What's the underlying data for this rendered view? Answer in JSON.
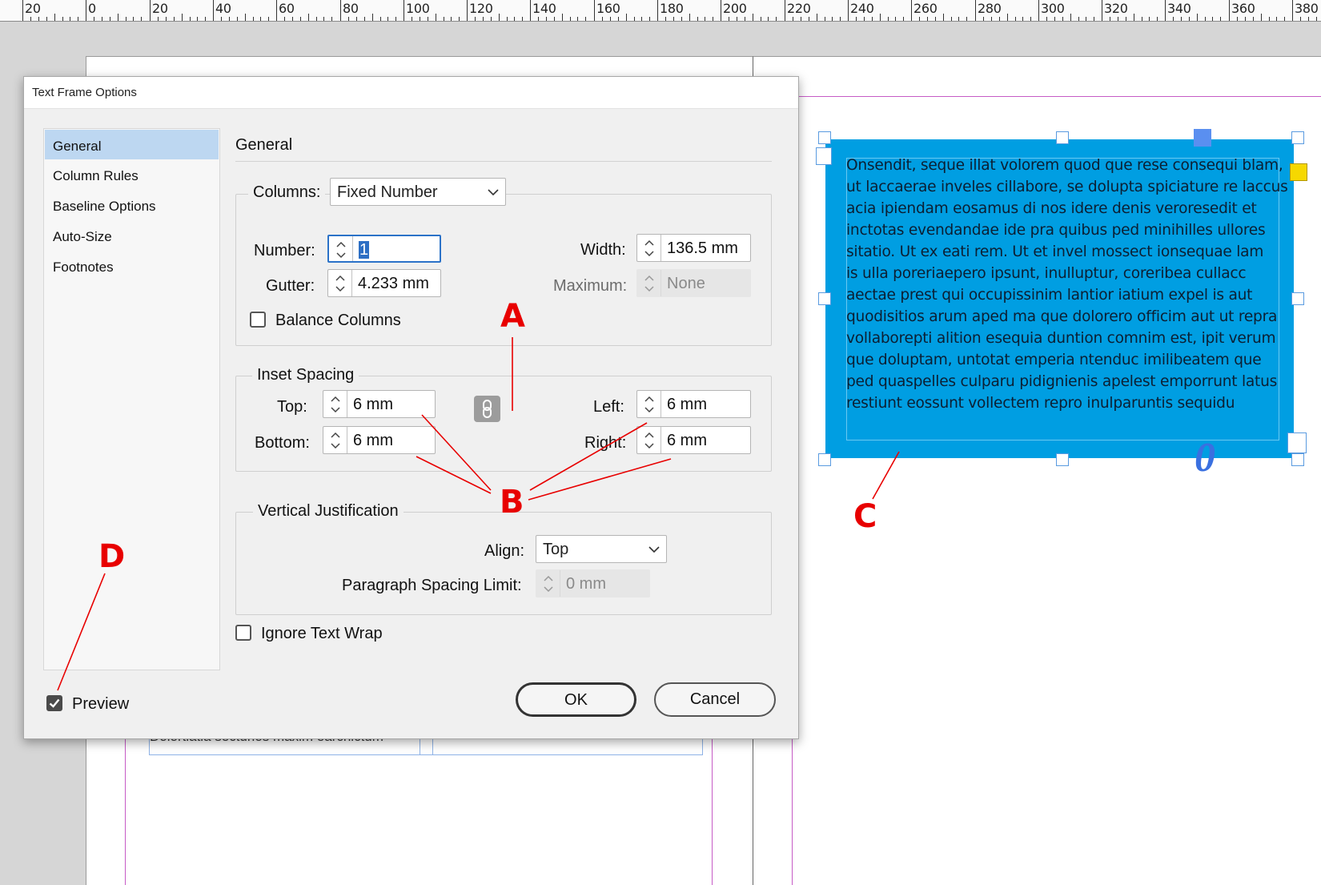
{
  "ruler": {
    "labels": [
      "20",
      "0",
      "20",
      "40",
      "60",
      "80",
      "100",
      "120",
      "140",
      "160",
      "180",
      "200",
      "220",
      "240",
      "260",
      "280",
      "300",
      "320",
      "340",
      "360",
      "380"
    ]
  },
  "text_frame": {
    "lines": [
      "Onsendit, seque illat volorem quod que rese consequi blam,",
      "ut laccaerae inveles cillabore, se dolupta spiciature re laccus",
      "acia ipiendam eosamus di nos idere denis veroresedit et",
      "inctotas evendandae ide pra quibus ped minihilles ullores",
      "sitatio. Ut ex eati rem. Ut et invel mossect ionsequae lam",
      "is ulla poreriaepero ipsunt, inulluptur, coreribea cullacc",
      "aectae prest qui occupissinim lantior iatium expel is aut",
      "quodisitios arum aped ma que dolorero officim aut ut repra",
      "vollaborepti alition esequia duntion comnim est, ipit verum",
      "que doluptam, untotat emperia ntenduc imilibeatem que",
      "ped quaspelles culparu pidignienis apelest emporrunt latus",
      "restiunt eossunt vollectem repro inulparuntis sequidu"
    ],
    "overset_glyph": "0",
    "fill_color": "#009ee2"
  },
  "background_text": "Dolortiatia secturios maxim earchictum",
  "dialog": {
    "title": "Text Frame Options",
    "nav": [
      "General",
      "Column Rules",
      "Baseline Options",
      "Auto-Size",
      "Footnotes"
    ],
    "section_heading": "General",
    "columns": {
      "label": "Columns:",
      "type_value": "Fixed Number",
      "number_label": "Number:",
      "number_value": "1",
      "gutter_label": "Gutter:",
      "gutter_value": "4.233 mm",
      "width_label": "Width:",
      "width_value": "136.5 mm",
      "maximum_label": "Maximum:",
      "maximum_value": "None",
      "balance_label": "Balance Columns",
      "balance_checked": false
    },
    "inset": {
      "heading": "Inset Spacing",
      "top_label": "Top:",
      "top_value": "6 mm",
      "bottom_label": "Bottom:",
      "bottom_value": "6 mm",
      "left_label": "Left:",
      "left_value": "6 mm",
      "right_label": "Right:",
      "right_value": "6 mm"
    },
    "vertical": {
      "heading": "Vertical Justification",
      "align_label": "Align:",
      "align_value": "Top",
      "psl_label": "Paragraph Spacing Limit:",
      "psl_value": "0 mm"
    },
    "ignore_wrap_label": "Ignore Text Wrap",
    "ignore_wrap_checked": false,
    "preview_label": "Preview",
    "preview_checked": true,
    "ok_label": "OK",
    "cancel_label": "Cancel"
  },
  "annotations": {
    "a": "A",
    "b": "B",
    "c": "C",
    "d": "D",
    "color": "#e80000"
  }
}
